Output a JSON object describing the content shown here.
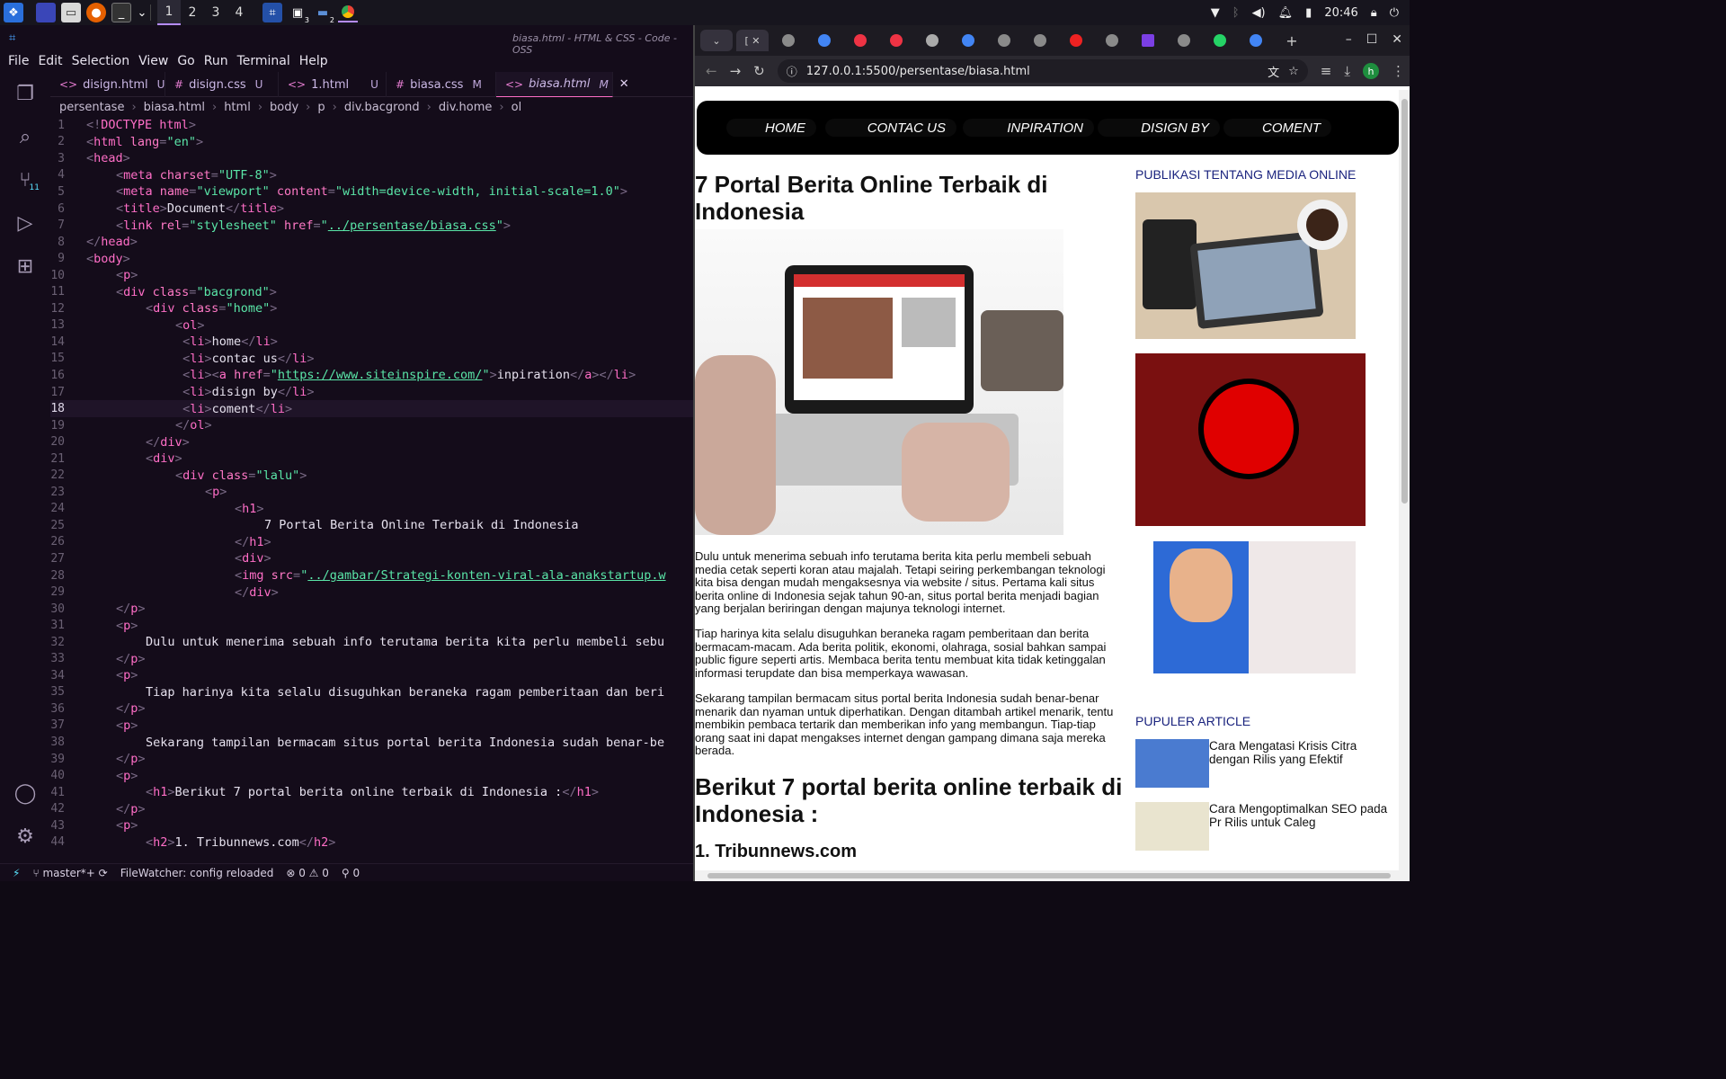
{
  "taskbar": {
    "workspaces": [
      "1",
      "2",
      "3",
      "4"
    ],
    "active_workspace": "1",
    "badge_a": "3",
    "badge_b": "2",
    "clock": "20:46"
  },
  "vscode": {
    "title": "biasa.html - HTML & CSS - Code - OSS",
    "menu": [
      "File",
      "Edit",
      "Selection",
      "View",
      "Go",
      "Run",
      "Terminal",
      "Help"
    ],
    "scm_badge": "11",
    "tabs": [
      {
        "name": "disign.html",
        "status": "U",
        "glyph": "<>"
      },
      {
        "name": "disign.css",
        "status": "U",
        "glyph": "#"
      },
      {
        "name": "1.html",
        "status": "U",
        "glyph": "<>"
      },
      {
        "name": "biasa.css",
        "status": "M",
        "glyph": "#"
      },
      {
        "name": "biasa.html",
        "status": "M",
        "glyph": "<>"
      }
    ],
    "breadcrumbs": [
      "persentase",
      "biasa.html",
      "html",
      "body",
      "p",
      "div.bacgrond",
      "div.home",
      "ol"
    ],
    "current_line": "18",
    "lines": [
      {
        "n": "1",
        "i": 0,
        "s": [
          [
            "br",
            "<!"
          ],
          [
            "tg",
            "DOCTYPE html"
          ],
          [
            "br",
            ">"
          ]
        ]
      },
      {
        "n": "2",
        "i": 0,
        "s": [
          [
            "br",
            "<"
          ],
          [
            "tg",
            "html "
          ],
          [
            "at",
            "lang"
          ],
          [
            "br",
            "="
          ],
          [
            "vl",
            "\"en\""
          ],
          [
            "br",
            ">"
          ]
        ]
      },
      {
        "n": "3",
        "i": 0,
        "s": [
          [
            "br",
            "<"
          ],
          [
            "tg",
            "head"
          ],
          [
            "br",
            ">"
          ]
        ]
      },
      {
        "n": "4",
        "i": 1,
        "s": [
          [
            "br",
            "<"
          ],
          [
            "tg",
            "meta "
          ],
          [
            "at",
            "charset"
          ],
          [
            "br",
            "="
          ],
          [
            "vl",
            "\"UTF-8\""
          ],
          [
            "br",
            ">"
          ]
        ]
      },
      {
        "n": "5",
        "i": 1,
        "s": [
          [
            "br",
            "<"
          ],
          [
            "tg",
            "meta "
          ],
          [
            "at",
            "name"
          ],
          [
            "br",
            "="
          ],
          [
            "vl",
            "\"viewport\" "
          ],
          [
            "at",
            "content"
          ],
          [
            "br",
            "="
          ],
          [
            "vl",
            "\"width=device-width, initial-scale=1.0\""
          ],
          [
            "br",
            ">"
          ]
        ]
      },
      {
        "n": "6",
        "i": 1,
        "s": [
          [
            "br",
            "<"
          ],
          [
            "tg",
            "title"
          ],
          [
            "br",
            ">"
          ],
          [
            "tx",
            "Document"
          ],
          [
            "br",
            "</"
          ],
          [
            "tg",
            "title"
          ],
          [
            "br",
            ">"
          ]
        ]
      },
      {
        "n": "7",
        "i": 1,
        "s": [
          [
            "br",
            "<"
          ],
          [
            "tg",
            "link "
          ],
          [
            "at",
            "rel"
          ],
          [
            "br",
            "="
          ],
          [
            "vl",
            "\"stylesheet\" "
          ],
          [
            "at",
            "href"
          ],
          [
            "br",
            "="
          ],
          [
            "vl",
            "\""
          ],
          [
            "lk",
            "../persentase/biasa.css"
          ],
          [
            "vl",
            "\""
          ],
          [
            "br",
            ">"
          ]
        ]
      },
      {
        "n": "8",
        "i": 0,
        "s": [
          [
            "br",
            "</"
          ],
          [
            "tg",
            "head"
          ],
          [
            "br",
            ">"
          ]
        ]
      },
      {
        "n": "9",
        "i": 0,
        "s": [
          [
            "br",
            "<"
          ],
          [
            "tg",
            "body"
          ],
          [
            "br",
            ">"
          ]
        ]
      },
      {
        "n": "10",
        "i": 1,
        "s": [
          [
            "br",
            "<"
          ],
          [
            "tg",
            "p"
          ],
          [
            "br",
            ">"
          ]
        ]
      },
      {
        "n": "11",
        "i": 1,
        "s": [
          [
            "br",
            "<"
          ],
          [
            "tg",
            "div "
          ],
          [
            "at",
            "class"
          ],
          [
            "br",
            "="
          ],
          [
            "vl",
            "\"bacgrond\""
          ],
          [
            "br",
            ">"
          ]
        ]
      },
      {
        "n": "12",
        "i": 2,
        "s": [
          [
            "br",
            "<"
          ],
          [
            "tg",
            "div "
          ],
          [
            "at",
            "class"
          ],
          [
            "br",
            "="
          ],
          [
            "vl",
            "\"home\""
          ],
          [
            "br",
            ">"
          ]
        ]
      },
      {
        "n": "13",
        "i": 3,
        "s": [
          [
            "br",
            "<"
          ],
          [
            "tg",
            "ol"
          ],
          [
            "br",
            ">"
          ]
        ]
      },
      {
        "n": "14",
        "i": 3,
        "s": [
          [
            "br",
            " <"
          ],
          [
            "tg",
            "li"
          ],
          [
            "br",
            ">"
          ],
          [
            "tx",
            "home"
          ],
          [
            "br",
            "</"
          ],
          [
            "tg",
            "li"
          ],
          [
            "br",
            ">"
          ]
        ]
      },
      {
        "n": "15",
        "i": 3,
        "s": [
          [
            "br",
            " <"
          ],
          [
            "tg",
            "li"
          ],
          [
            "br",
            ">"
          ],
          [
            "tx",
            "contac us"
          ],
          [
            "br",
            "</"
          ],
          [
            "tg",
            "li"
          ],
          [
            "br",
            ">"
          ]
        ]
      },
      {
        "n": "16",
        "i": 3,
        "s": [
          [
            "br",
            " <"
          ],
          [
            "tg",
            "li"
          ],
          [
            "br",
            "><"
          ],
          [
            "tg",
            "a "
          ],
          [
            "at",
            "href"
          ],
          [
            "br",
            "="
          ],
          [
            "vl",
            "\""
          ],
          [
            "lk",
            "https://www.siteinspire.com/"
          ],
          [
            "vl",
            "\""
          ],
          [
            "br",
            ">"
          ],
          [
            "tx",
            "inpiration"
          ],
          [
            "br",
            "</"
          ],
          [
            "tg",
            "a"
          ],
          [
            "br",
            "></"
          ],
          [
            "tg",
            "li"
          ],
          [
            "br",
            ">"
          ]
        ]
      },
      {
        "n": "17",
        "i": 3,
        "s": [
          [
            "br",
            " <"
          ],
          [
            "tg",
            "li"
          ],
          [
            "br",
            ">"
          ],
          [
            "tx",
            "disign by"
          ],
          [
            "br",
            "</"
          ],
          [
            "tg",
            "li"
          ],
          [
            "br",
            ">"
          ]
        ]
      },
      {
        "n": "18",
        "i": 3,
        "s": [
          [
            "br",
            " <"
          ],
          [
            "tg",
            "li"
          ],
          [
            "br",
            ">"
          ],
          [
            "tx",
            "coment"
          ],
          [
            "br",
            "</"
          ],
          [
            "tg",
            "li"
          ],
          [
            "br",
            ">"
          ]
        ]
      },
      {
        "n": "19",
        "i": 3,
        "s": [
          [
            "br",
            "</"
          ],
          [
            "tg",
            "ol"
          ],
          [
            "br",
            ">"
          ]
        ]
      },
      {
        "n": "20",
        "i": 2,
        "s": [
          [
            "br",
            "</"
          ],
          [
            "tg",
            "div"
          ],
          [
            "br",
            ">"
          ]
        ]
      },
      {
        "n": "21",
        "i": 2,
        "s": [
          [
            "br",
            "<"
          ],
          [
            "tg",
            "div"
          ],
          [
            "br",
            ">"
          ]
        ]
      },
      {
        "n": "22",
        "i": 3,
        "s": [
          [
            "br",
            "<"
          ],
          [
            "tg",
            "div "
          ],
          [
            "at",
            "class"
          ],
          [
            "br",
            "="
          ],
          [
            "vl",
            "\"lalu\""
          ],
          [
            "br",
            ">"
          ]
        ]
      },
      {
        "n": "23",
        "i": 4,
        "s": [
          [
            "br",
            "<"
          ],
          [
            "tg",
            "p"
          ],
          [
            "br",
            ">"
          ]
        ]
      },
      {
        "n": "24",
        "i": 5,
        "s": [
          [
            "br",
            "<"
          ],
          [
            "tg",
            "h1"
          ],
          [
            "br",
            ">"
          ]
        ]
      },
      {
        "n": "25",
        "i": 6,
        "s": [
          [
            "tx",
            "7 Portal Berita Online Terbaik di Indonesia"
          ]
        ]
      },
      {
        "n": "26",
        "i": 5,
        "s": [
          [
            "br",
            "</"
          ],
          [
            "tg",
            "h1"
          ],
          [
            "br",
            ">"
          ]
        ]
      },
      {
        "n": "27",
        "i": 5,
        "s": [
          [
            "br",
            "<"
          ],
          [
            "tg",
            "div"
          ],
          [
            "br",
            ">"
          ]
        ]
      },
      {
        "n": "28",
        "i": 5,
        "s": [
          [
            "br",
            "<"
          ],
          [
            "tg",
            "img "
          ],
          [
            "at",
            "src"
          ],
          [
            "br",
            "="
          ],
          [
            "vl",
            "\""
          ],
          [
            "lk",
            "../gambar/Strategi-konten-viral-ala-anakstartup.w"
          ]
        ]
      },
      {
        "n": "29",
        "i": 5,
        "s": [
          [
            "br",
            "</"
          ],
          [
            "tg",
            "div"
          ],
          [
            "br",
            ">"
          ]
        ]
      },
      {
        "n": "30",
        "i": 1,
        "s": [
          [
            "br",
            "</"
          ],
          [
            "tg",
            "p"
          ],
          [
            "br",
            ">"
          ]
        ]
      },
      {
        "n": "31",
        "i": 1,
        "s": [
          [
            "br",
            "<"
          ],
          [
            "tg",
            "p"
          ],
          [
            "br",
            ">"
          ]
        ]
      },
      {
        "n": "32",
        "i": 2,
        "s": [
          [
            "tx",
            "Dulu untuk menerima sebuah info terutama berita kita perlu membeli sebu"
          ]
        ]
      },
      {
        "n": "33",
        "i": 1,
        "s": [
          [
            "br",
            "</"
          ],
          [
            "tg",
            "p"
          ],
          [
            "br",
            ">"
          ]
        ]
      },
      {
        "n": "34",
        "i": 1,
        "s": [
          [
            "br",
            "<"
          ],
          [
            "tg",
            "p"
          ],
          [
            "br",
            ">"
          ]
        ]
      },
      {
        "n": "35",
        "i": 2,
        "s": [
          [
            "tx",
            "Tiap harinya kita selalu disuguhkan beraneka ragam pemberitaan dan beri"
          ]
        ]
      },
      {
        "n": "36",
        "i": 1,
        "s": [
          [
            "br",
            "</"
          ],
          [
            "tg",
            "p"
          ],
          [
            "br",
            ">"
          ]
        ]
      },
      {
        "n": "37",
        "i": 1,
        "s": [
          [
            "br",
            "<"
          ],
          [
            "tg",
            "p"
          ],
          [
            "br",
            ">"
          ]
        ]
      },
      {
        "n": "38",
        "i": 2,
        "s": [
          [
            "tx",
            "Sekarang tampilan bermacam situs portal berita Indonesia sudah benar-be"
          ]
        ]
      },
      {
        "n": "39",
        "i": 1,
        "s": [
          [
            "br",
            "</"
          ],
          [
            "tg",
            "p"
          ],
          [
            "br",
            ">"
          ]
        ]
      },
      {
        "n": "40",
        "i": 1,
        "s": [
          [
            "br",
            "<"
          ],
          [
            "tg",
            "p"
          ],
          [
            "br",
            ">"
          ]
        ]
      },
      {
        "n": "41",
        "i": 2,
        "s": [
          [
            "br",
            "<"
          ],
          [
            "tg",
            "h1"
          ],
          [
            "br",
            ">"
          ],
          [
            "tx",
            "Berikut 7 portal berita online terbaik di Indonesia :"
          ],
          [
            "br",
            "</"
          ],
          [
            "tg",
            "h1"
          ],
          [
            "br",
            ">"
          ]
        ]
      },
      {
        "n": "42",
        "i": 1,
        "s": [
          [
            "br",
            "</"
          ],
          [
            "tg",
            "p"
          ],
          [
            "br",
            ">"
          ]
        ]
      },
      {
        "n": "43",
        "i": 1,
        "s": [
          [
            "br",
            "<"
          ],
          [
            "tg",
            "p"
          ],
          [
            "br",
            ">"
          ]
        ]
      },
      {
        "n": "44",
        "i": 2,
        "s": [
          [
            "br",
            "<"
          ],
          [
            "tg",
            "h2"
          ],
          [
            "br",
            ">"
          ],
          [
            "tx",
            "1. Tribunnews.com"
          ],
          [
            "br",
            "</"
          ],
          [
            "tg",
            "h2"
          ],
          [
            "br",
            ">"
          ]
        ]
      }
    ],
    "status": {
      "branch": "master*+",
      "watcher": "FileWatcher: config reloaded",
      "errors": "0",
      "warnings": "0",
      "ports": "0"
    }
  },
  "browser": {
    "url": "127.0.0.1:5500/persentase/biasa.html",
    "profile": "h",
    "page": {
      "nav": [
        "HOME",
        "CONTAC US",
        "INPIRATION",
        "DISIGN BY",
        "COMENT"
      ],
      "title": "7 Portal Berita Online Terbaik di Indonesia",
      "p1": "Dulu untuk menerima sebuah info terutama berita kita perlu membeli sebuah media cetak seperti koran atau majalah. Tetapi seiring perkembangan teknologi kita bisa dengan mudah mengaksesnya via website / situs. Pertama kali situs berita online di Indonesia sejak tahun 90-an, situs portal berita menjadi bagian yang berjalan beriringan dengan majunya teknologi internet.",
      "p2": "Tiap harinya kita selalu disuguhkan beraneka ragam pemberitaan dan berita bermacam-macam. Ada berita politik, ekonomi, olahraga, sosial bahkan sampai public figure seperti artis. Membaca berita tentu membuat kita tidak ketinggalan informasi terupdate dan bisa memperkaya wawasan.",
      "p3": "Sekarang tampilan bermacam situs portal berita Indonesia sudah benar-benar menarik dan nyaman untuk diperhatikan. Dengan ditambah artikel menarik, tentu membikin pembaca tertarik dan memberikan info yang membangun. Tiap-tiap orang saat ini dapat mengakses internet dengan gampang dimana saja mereka berada.",
      "h_list": "Berikut 7 portal berita online terbaik di Indonesia :",
      "h2_first": "1. Tribunnews.com",
      "side_heading": "PUBLIKASI TENTANG MEDIA ONLINE",
      "popular_heading": "PUPULER ARTICLE",
      "articles": [
        "Cara Mengatasi Krisis Citra dengan Rilis yang Efektif",
        "Cara Mengoptimalkan SEO pada Pr Rilis untuk Caleg"
      ]
    }
  }
}
